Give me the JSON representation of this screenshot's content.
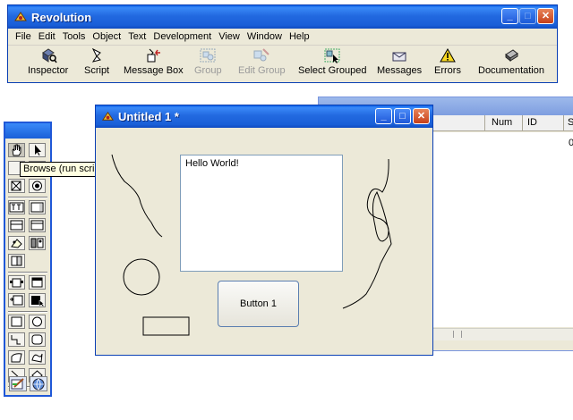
{
  "main_window": {
    "title": "Revolution",
    "menu": [
      "File",
      "Edit",
      "Tools",
      "Object",
      "Text",
      "Development",
      "View",
      "Window",
      "Help"
    ],
    "toolbar": {
      "inspector": "Inspector",
      "script": "Script",
      "message_box": "Message Box",
      "group": "Group",
      "edit_group": "Edit Group",
      "select_grouped": "Select Grouped",
      "messages": "Messages",
      "errors": "Errors",
      "documentation": "Documentation"
    }
  },
  "background_window": {
    "columns": [
      "Num",
      "ID",
      "S"
    ],
    "first_cell": "0"
  },
  "tooltip": "Browse (run scripts and interact)",
  "stack_window": {
    "title": "Untitled 1 *",
    "field_text": "Hello World!",
    "button_label": "Button 1"
  },
  "colors": {
    "title_blue": "#1f58d8",
    "window_face": "#ece9d8",
    "close_red": "#c6401a"
  }
}
